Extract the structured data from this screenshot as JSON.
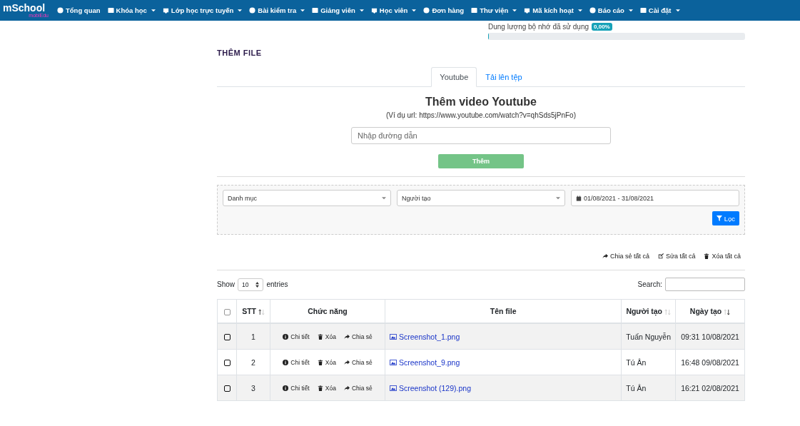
{
  "navbar": {
    "logo": {
      "main": "mSchool",
      "sub": "mobiEdu"
    },
    "items": [
      {
        "label": "Tổng quan",
        "dropdown": false
      },
      {
        "label": "Khóa học",
        "dropdown": true
      },
      {
        "label": "Lớp học trực tuyến",
        "dropdown": true
      },
      {
        "label": "Bài kiểm tra",
        "dropdown": true
      },
      {
        "label": "Giảng viên",
        "dropdown": true
      },
      {
        "label": "Học viên",
        "dropdown": true
      },
      {
        "label": "Đơn hàng",
        "dropdown": false
      },
      {
        "label": "Thư viện",
        "dropdown": true
      },
      {
        "label": "Mã kích hoạt",
        "dropdown": true
      },
      {
        "label": "Báo cáo",
        "dropdown": true
      },
      {
        "label": "Cài đặt",
        "dropdown": true
      }
    ]
  },
  "storage": {
    "label": "Dung lượng bộ nhớ đã sử dụng",
    "badge": "0,00%",
    "level": 0
  },
  "section_title": "THÊM FILE",
  "tabs": [
    {
      "label": "Youtube",
      "selected": true
    },
    {
      "label": "Tải lên tệp",
      "selected": false
    }
  ],
  "youtube": {
    "heading": "Thêm video Youtube",
    "hint": "(Ví dụ url: https://www.youtube.com/watch?v=qhSds5jPnFo)",
    "url_field": {
      "placeholder": "Nhập đường dẫn"
    },
    "add_button": "Thêm"
  },
  "filters": {
    "category": "Danh mục",
    "creator": "Người tạo",
    "date_range": "01/08/2021 - 31/08/2021",
    "filter_button": "Lọc"
  },
  "bulk_actions": [
    "Chia sẻ tất cả",
    "Sửa tất cả",
    "Xóa tất cả"
  ],
  "table_controls": {
    "show": "Show",
    "page_size": "10",
    "entries": "entries",
    "search": "Search:"
  },
  "table": {
    "header_checked": false,
    "columns": [
      {
        "label": "STT",
        "sortable": true,
        "sorted_up": true,
        "sorted_down": false
      },
      {
        "label": "Chức năng",
        "sortable": false
      },
      {
        "label": "Tên file",
        "sortable": false
      },
      {
        "label": "Người tạo",
        "sortable": true,
        "sorted_up": false,
        "sorted_down": false
      },
      {
        "label": "Ngày tạo",
        "sortable": true,
        "sorted_up": false,
        "sorted_down": true
      }
    ],
    "rows": [
      {
        "checked": false,
        "stt": "1",
        "actions": [
          "Chi tiết",
          "Xóa",
          "Chia sẻ"
        ],
        "file": "Screenshot_1.png",
        "creator": "Tuấn Nguyễn",
        "date": "09:31 10/08/2021"
      },
      {
        "checked": false,
        "stt": "2",
        "actions": [
          "Chi tiết",
          "Xóa",
          "Chia sẻ"
        ],
        "file": "Screenshot_9.png",
        "creator": "Tú Ân",
        "date": "16:48 09/08/2021"
      },
      {
        "checked": false,
        "stt": "3",
        "actions": [
          "Chi tiết",
          "Xóa",
          "Chia sẻ"
        ],
        "file": "Screenshot (129).png",
        "creator": "Tú Ân",
        "date": "16:21 02/08/2021"
      }
    ]
  }
}
